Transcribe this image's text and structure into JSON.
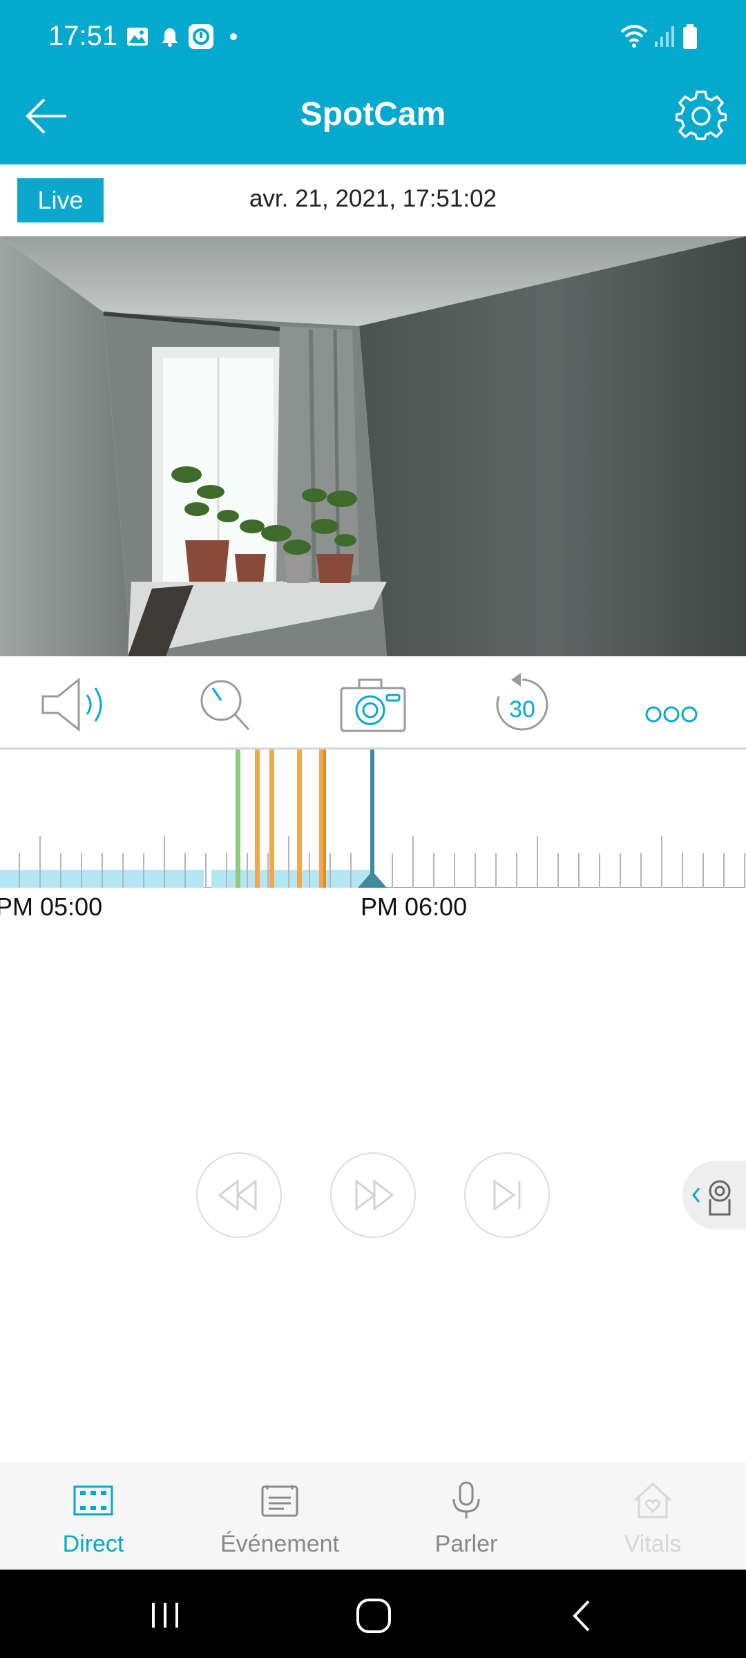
{
  "status_bar": {
    "time": "17:51",
    "icons": [
      "gallery-icon",
      "bell-icon",
      "app-notification-icon",
      "dot-icon",
      "wifi-icon",
      "signal-icon",
      "battery-icon"
    ]
  },
  "header": {
    "title": "SpotCam",
    "back_icon": "back-arrow-icon",
    "settings_icon": "gear-icon"
  },
  "live_row": {
    "badge": "Live",
    "datetime": "avr. 21,  2021, 17:51:02"
  },
  "controls": [
    {
      "name": "speaker-icon"
    },
    {
      "name": "zoom-icon"
    },
    {
      "name": "camera-snapshot-icon"
    },
    {
      "name": "rewind-30-icon",
      "label": "30"
    },
    {
      "name": "more-icon"
    }
  ],
  "timeline": {
    "labels": [
      "PM 05:00",
      "PM 06:00"
    ]
  },
  "playback": {
    "buttons": [
      "rewind-icon",
      "fast-forward-icon",
      "skip-next-icon"
    ],
    "side_tab_icon": "camera-person-icon"
  },
  "bottom_nav": {
    "items": [
      {
        "label": "Direct",
        "icon": "film-icon",
        "active": true
      },
      {
        "label": "Événement",
        "icon": "event-list-icon",
        "active": false
      },
      {
        "label": "Parler",
        "icon": "microphone-icon",
        "active": false
      },
      {
        "label": "Vitals",
        "icon": "home-heart-icon",
        "active": false,
        "disabled": true
      }
    ]
  },
  "colors": {
    "brand": "#04a9cd",
    "accent": "#09a8cc",
    "motion_event": "#8fc97a",
    "sound_event": "#f2a74a",
    "playhead": "#3f8aa0",
    "recording_bar": "#b4e7f5"
  }
}
